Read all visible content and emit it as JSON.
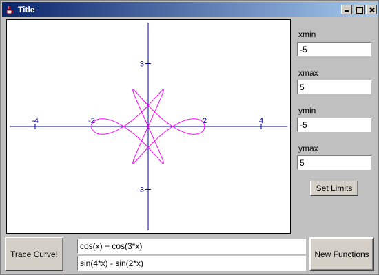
{
  "window": {
    "title": "Title"
  },
  "controls": {
    "minimize": "minimize",
    "maximize": "maximize",
    "close": "close"
  },
  "plot": {
    "xmin": -5,
    "xmax": 5,
    "ymin": -5,
    "ymax": 5,
    "x_ticks": [
      "-4",
      "-2",
      "2",
      "4"
    ],
    "y_ticks": [
      "3",
      "-3"
    ],
    "axis_color": "#00008b",
    "curve_color": "#ff00ff",
    "x_expr": "cos(x) + cos(3*x)",
    "y_expr": "sin(4*x) - sin(2*x)"
  },
  "limits": {
    "xmin_label": "xmin",
    "xmin_value": "-5",
    "xmax_label": "xmax",
    "xmax_value": "5",
    "ymin_label": "ymin",
    "ymin_value": "-5",
    "ymax_label": "ymax",
    "ymax_value": "5",
    "set_button": "Set Limits"
  },
  "functions": {
    "trace_button": "Trace Curve!",
    "x_function": "cos(x) + cos(3*x)",
    "y_function": "sin(4*x) - sin(2*x)",
    "new_button": "New Functions"
  }
}
